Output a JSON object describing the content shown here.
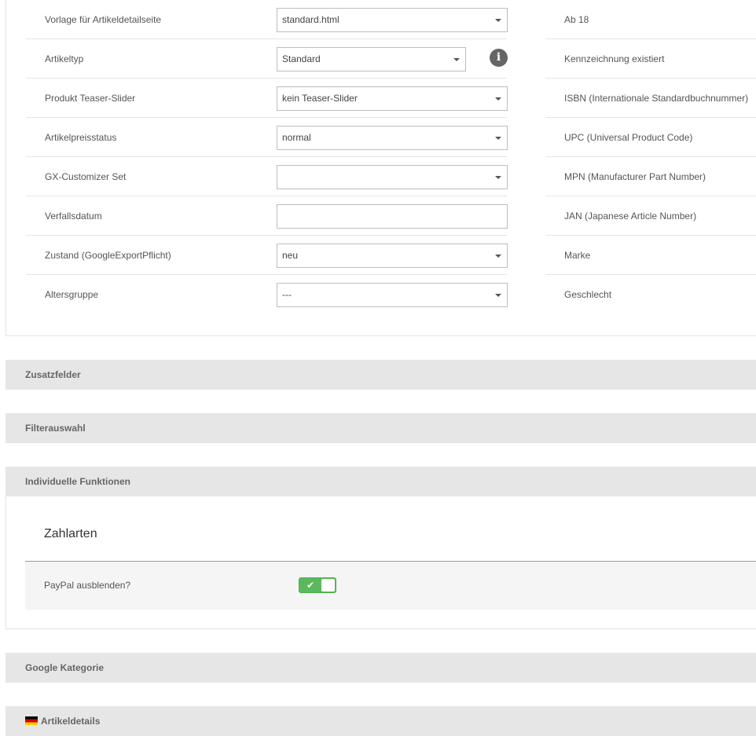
{
  "left_fields": [
    {
      "label": "Vorlage für Artikeldetailseite",
      "value": "standard.html",
      "type": "select"
    },
    {
      "label": "Artikeltyp",
      "value": "Standard",
      "type": "select-info"
    },
    {
      "label": "Produkt Teaser-Slider",
      "value": "kein Teaser-Slider",
      "type": "select"
    },
    {
      "label": "Artikelpreisstatus",
      "value": "normal",
      "type": "select"
    },
    {
      "label": "GX-Customizer Set",
      "value": "",
      "type": "select"
    },
    {
      "label": "Verfallsdatum",
      "value": "",
      "type": "input"
    },
    {
      "label": "Zustand (GoogleExportPflicht)",
      "value": "neu",
      "type": "select"
    },
    {
      "label": "Altersgruppe",
      "value": "---",
      "type": "select"
    }
  ],
  "right_fields": [
    {
      "label": "Ab 18"
    },
    {
      "label": "Kennzeichnung existiert"
    },
    {
      "label": "ISBN (Internationale Standardbuchnummer)"
    },
    {
      "label": "UPC (Universal Product Code)"
    },
    {
      "label": "MPN (Manufacturer Part Number)"
    },
    {
      "label": "JAN (Japanese Article Number)"
    },
    {
      "label": "Marke"
    },
    {
      "label": "Geschlecht"
    }
  ],
  "sections": {
    "zusatzfelder": "Zusatzfelder",
    "filterauswahl": "Filterauswahl",
    "individuelle": "Individuelle Funktionen",
    "google": "Google Kategorie",
    "artikeldetails": "Artikeldetails"
  },
  "individuelle_panel": {
    "heading": "Zahlarten",
    "paypal_label": "PayPal ausblenden?",
    "paypal_enabled": true,
    "check_icon": "✔"
  },
  "icons": {
    "info": "i"
  },
  "colors": {
    "toggle_on": "#5cb85c",
    "section_bar": "#e6e6e6"
  }
}
